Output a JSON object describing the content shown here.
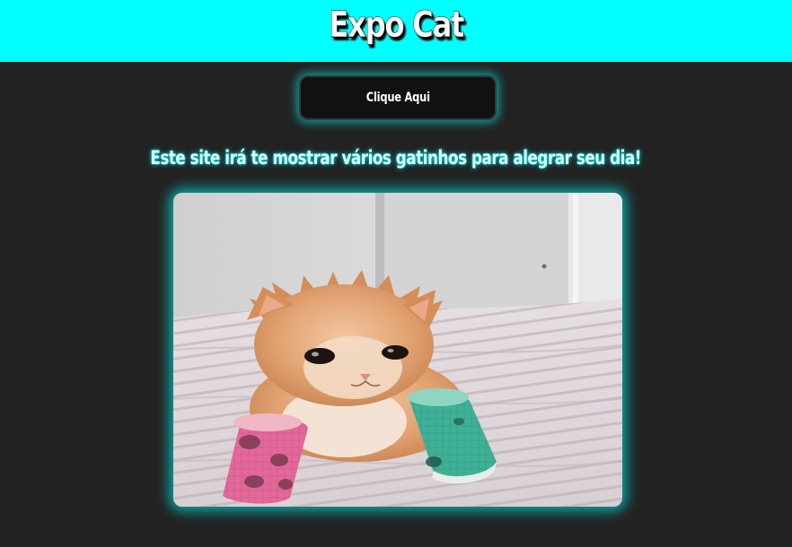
{
  "header": {
    "title": "Expo Cat",
    "background_color": "#00ffff"
  },
  "button": {
    "label": "Clique Aqui"
  },
  "tagline": "Este site irá te mostrar vários gatinhos para alegrar seu dia!",
  "image": {
    "subject": "orange kitten with pink and teal bandaged legs",
    "icon": "kitten-photo"
  },
  "colors": {
    "page_background": "#222222",
    "accent_glow": "#00ffff"
  }
}
